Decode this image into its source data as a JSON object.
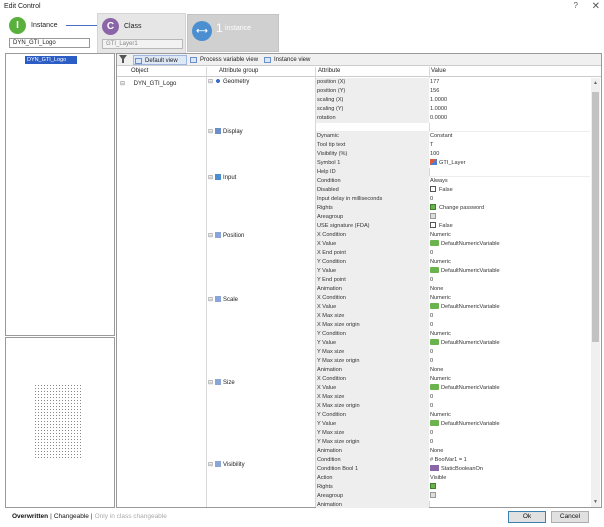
{
  "window": {
    "title": "Edit Control",
    "help": "?",
    "close": "✕"
  },
  "steps": [
    {
      "letter": "I",
      "label": "Instance",
      "value": "DYN_GTI_Logo",
      "color": "#5ab03c"
    },
    {
      "letter": "C",
      "label": "Class",
      "value": "GTI_Layer1",
      "color": "#8c65a8"
    },
    {
      "number": "1",
      "label": "instance",
      "color": "#4b8fd0"
    }
  ],
  "tree": {
    "selected": "DYN_GTI_Logo"
  },
  "toolbar": {
    "default_view": "Default view",
    "process_view": "Process variable view",
    "instance_view": "Instance view"
  },
  "columns": {
    "object": "Object",
    "group": "Attribute group",
    "attribute": "Attribute",
    "value": "Value"
  },
  "object": "DYN_GTI_Logo",
  "groups": [
    "Geometry",
    "Display",
    "Input",
    "Position",
    "Scale",
    "Size",
    "Visibility"
  ],
  "rows": [
    {
      "a": "position (X)",
      "v": "177"
    },
    {
      "a": "position (Y)",
      "v": "156"
    },
    {
      "a": "scaling (X)",
      "v": "1.0000"
    },
    {
      "a": "scaling (Y)",
      "v": "1.0000"
    },
    {
      "a": "rotation",
      "v": "0.0000"
    },
    {
      "a": "",
      "v": ""
    },
    {
      "a": "Dynamic",
      "v": "Constant"
    },
    {
      "a": "Tool tip text",
      "v": "T"
    },
    {
      "a": "Visibility (%)",
      "v": "100"
    },
    {
      "a": "Symbol 1",
      "v": "GTI_Layer"
    },
    {
      "a": "Help ID",
      "v": ""
    },
    {
      "a": "Condition",
      "v": "Always"
    },
    {
      "a": "Disabled",
      "v": "False"
    },
    {
      "a": "Input delay in milliseconds",
      "v": "0"
    },
    {
      "a": "Rights",
      "v": "Change password"
    },
    {
      "a": "Areagroup",
      "v": ""
    },
    {
      "a": "USE signature (FDA)",
      "v": "False"
    },
    {
      "a": "X Condition",
      "v": "Numeric"
    },
    {
      "a": "X Value",
      "v": "DefaultNumericVariable"
    },
    {
      "a": "X End point",
      "v": "0"
    },
    {
      "a": "Y Condition",
      "v": "Numeric"
    },
    {
      "a": "Y Value",
      "v": "DefaultNumericVariable"
    },
    {
      "a": "Y End point",
      "v": "0"
    },
    {
      "a": "Animation",
      "v": "None"
    },
    {
      "a": "X Condition",
      "v": "Numeric"
    },
    {
      "a": "X Value",
      "v": "DefaultNumericVariable"
    },
    {
      "a": "X Max size",
      "v": "0"
    },
    {
      "a": "X Max size origin",
      "v": "0"
    },
    {
      "a": "Y Condition",
      "v": "Numeric"
    },
    {
      "a": "Y Value",
      "v": "DefaultNumericVariable"
    },
    {
      "a": "Y Max size",
      "v": "0"
    },
    {
      "a": "Y Max size origin",
      "v": "0"
    },
    {
      "a": "Animation",
      "v": "None"
    },
    {
      "a": "X Condition",
      "v": "Numeric"
    },
    {
      "a": "X Value",
      "v": "DefaultNumericVariable"
    },
    {
      "a": "X Max size",
      "v": "0"
    },
    {
      "a": "X Max size origin",
      "v": "0"
    },
    {
      "a": "Y Condition",
      "v": "Numeric"
    },
    {
      "a": "Y Value",
      "v": "DefaultNumericVariable"
    },
    {
      "a": "Y Max size",
      "v": "0"
    },
    {
      "a": "Y Max size origin",
      "v": "0"
    },
    {
      "a": "Animation",
      "v": "None"
    },
    {
      "a": "Condition",
      "v": "# BoolVar1 = 1"
    },
    {
      "a": "Condition Bool 1",
      "v": "StaticBooleanOn"
    },
    {
      "a": "Action",
      "v": "Visible"
    },
    {
      "a": "Rights",
      "v": ""
    },
    {
      "a": "Areagroup",
      "v": ""
    },
    {
      "a": "Animation",
      "v": ""
    }
  ],
  "footer": {
    "mode1": "Overwritten",
    "mode2": "Changeable",
    "mode3": "Only in class changeable",
    "ok": "Ok",
    "cancel": "Cancel"
  }
}
